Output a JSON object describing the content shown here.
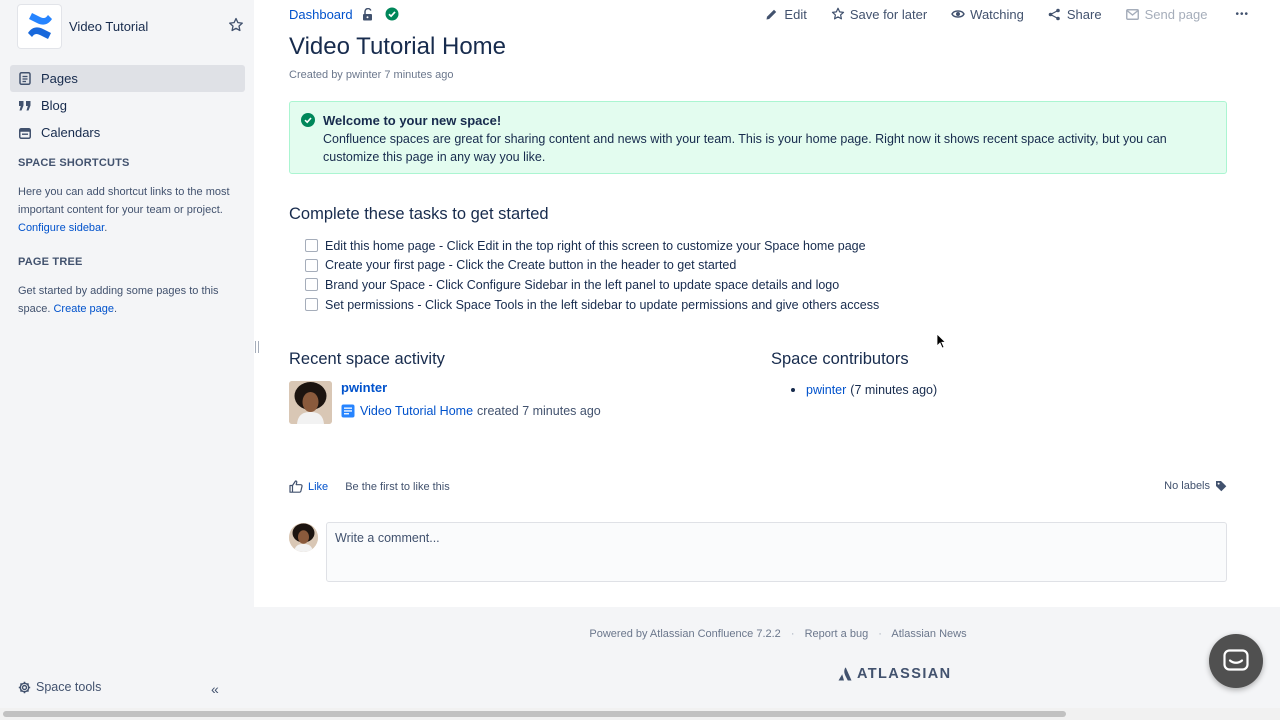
{
  "sidebar": {
    "space_name": "Video Tutorial",
    "nav": [
      {
        "label": "Pages",
        "icon": "page-icon",
        "active": true
      },
      {
        "label": "Blog",
        "icon": "quote-icon",
        "active": false
      },
      {
        "label": "Calendars",
        "icon": "calendar-icon",
        "active": false
      }
    ],
    "shortcuts_heading": "SPACE SHORTCUTS",
    "shortcuts_text": "Here you can add shortcut links to the most important content for your team or project.",
    "shortcuts_link": "Configure sidebar",
    "page_tree_heading": "PAGE TREE",
    "page_tree_text": "Get started by adding some pages to this space.",
    "page_tree_link": "Create page",
    "space_tools": "Space tools"
  },
  "topbar": {
    "breadcrumb": "Dashboard",
    "actions": {
      "edit": "Edit",
      "save_for_later": "Save for later",
      "watching": "Watching",
      "share": "Share",
      "send_page": "Send page",
      "more": "•••"
    }
  },
  "page": {
    "title": "Video Tutorial Home",
    "byline": "Created by pwinter 7 minutes ago",
    "info_title": "Welcome to your new space!",
    "info_body": "Confluence spaces are great for sharing content and news with your team. This is your home page. Right now it shows recent space activity, but you can customize this page in any way you like.",
    "tasks_heading": "Complete these tasks to get started",
    "tasks": [
      "Edit this home page - Click Edit in the top right of this screen to customize your Space home page",
      "Create your first page - Click the Create button in the header to get started",
      "Brand your Space - Click Configure Sidebar in the left panel to update space details and logo",
      "Set permissions - Click Space Tools in the left sidebar to update permissions and give others access"
    ],
    "recent_heading": "Recent space activity",
    "activity": {
      "user": "pwinter",
      "page_link": "Video Tutorial Home",
      "action_text": "created 7 minutes ago"
    },
    "contributors_heading": "Space contributors",
    "contributor": {
      "name": "pwinter",
      "time": "(7 minutes ago)"
    },
    "like_label": "Like",
    "like_hint": "Be the first to like this",
    "labels_text": "No labels",
    "comment_placeholder": "Write a comment..."
  },
  "footer": {
    "powered_by": "Powered by Atlassian Confluence 7.2.2",
    "report_bug": "Report a bug",
    "news": "Atlassian News",
    "separator": "·",
    "logo_text": "ATLASSIAN"
  },
  "colors": {
    "link": "#0052cc",
    "text": "#172b4d",
    "sidebar_bg": "#f4f5f7",
    "success_bg": "#e3fcef",
    "success_green": "#00875a",
    "confluence_blue": "#1868db"
  }
}
